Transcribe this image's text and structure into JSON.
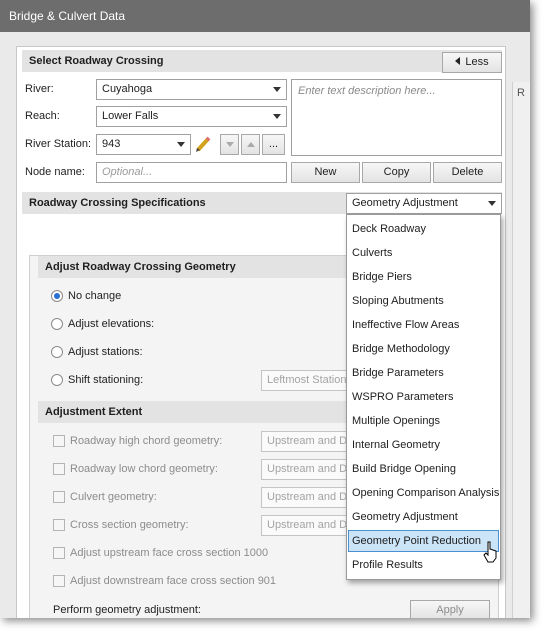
{
  "window": {
    "title": "Bridge & Culvert Data"
  },
  "select_section": {
    "header": "Select Roadway Crossing",
    "less_label": "Less",
    "river_label": "River:",
    "river_value": "Cuyahoga",
    "reach_label": "Reach:",
    "reach_value": "Lower Falls",
    "station_label": "River Station:",
    "station_value": "943",
    "node_label": "Node name:",
    "node_placeholder": "Optional...",
    "description_placeholder": "Enter text description here...",
    "new_label": "New",
    "copy_label": "Copy",
    "delete_label": "Delete",
    "station_more_label": "..."
  },
  "specs_section": {
    "header": "Roadway Crossing Specifications",
    "selected": "Geometry Adjustment",
    "options": [
      "Deck Roadway",
      "Culverts",
      "Bridge Piers",
      "Sloping Abutments",
      "Ineffective Flow Areas",
      "Bridge Methodology",
      "Bridge Parameters",
      "WSPRO Parameters",
      "Multiple Openings",
      "Internal Geometry",
      "Build Bridge Opening",
      "Opening Comparison Analysis",
      "Geometry Adjustment",
      "Geometry Point Reduction",
      "Profile Results"
    ],
    "highlighted": "Geometry Point Reduction"
  },
  "adjust_geometry": {
    "header": "Adjust Roadway Crossing Geometry",
    "options": [
      "No change",
      "Adjust elevations:",
      "Adjust stations:",
      "Shift stationing:"
    ],
    "selected": "No change",
    "shift_placeholder": "Leftmost Station"
  },
  "adjustment_extent": {
    "header": "Adjustment Extent",
    "items": [
      "Roadway high chord geometry:",
      "Roadway low chord geometry:",
      "Culvert geometry:",
      "Cross section geometry:",
      "Adjust upstream face cross section 1000",
      "Adjust downstream face cross section 901"
    ],
    "extent_value": "Upstream and Do",
    "perform_label": "Perform geometry adjustment:",
    "apply_label": "Apply"
  },
  "side_panel_letter": "R"
}
